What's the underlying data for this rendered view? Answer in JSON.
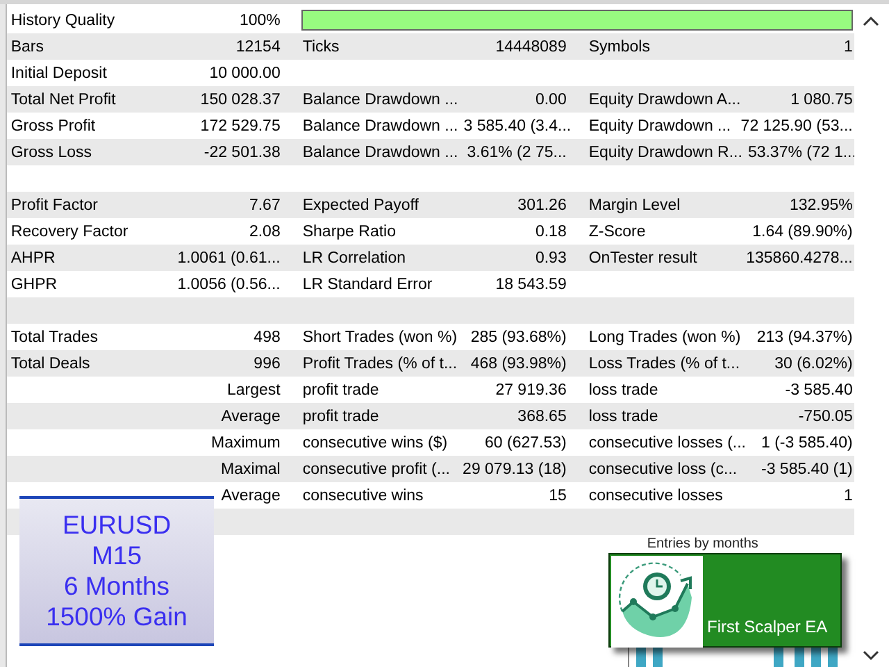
{
  "report": {
    "rows": [
      {
        "kind": "quality",
        "label": "History Quality",
        "value": "100%",
        "level": 1.0
      },
      {
        "kind": "stats",
        "cells": [
          {
            "label": "Bars",
            "value": "12154"
          },
          {
            "label": "Ticks",
            "value": "14448089"
          },
          {
            "label": "Symbols",
            "value": "1"
          }
        ]
      },
      {
        "kind": "stats",
        "cells": [
          {
            "label": "Initial Deposit",
            "value": "10 000.00"
          }
        ]
      },
      {
        "kind": "stats",
        "cells": [
          {
            "label": "Total Net Profit",
            "value": "150 028.37"
          },
          {
            "label": "Balance Drawdown ...",
            "value": "0.00"
          },
          {
            "label": "Equity Drawdown A...",
            "value": "1 080.75"
          }
        ]
      },
      {
        "kind": "stats",
        "cells": [
          {
            "label": "Gross Profit",
            "value": "172 529.75"
          },
          {
            "label": "Balance Drawdown ...",
            "value": "3 585.40 (3.4..."
          },
          {
            "label": "Equity Drawdown ...",
            "value": "72 125.90 (53..."
          }
        ]
      },
      {
        "kind": "stats",
        "cells": [
          {
            "label": "Gross Loss",
            "value": "-22 501.38"
          },
          {
            "label": "Balance Drawdown ...",
            "value": "3.61% (2 75..."
          },
          {
            "label": "Equity Drawdown R...",
            "value": "53.37% (72 1..."
          }
        ]
      },
      {
        "kind": "blank"
      },
      {
        "kind": "stats",
        "cells": [
          {
            "label": "Profit Factor",
            "value": "7.67"
          },
          {
            "label": "Expected Payoff",
            "value": "301.26"
          },
          {
            "label": "Margin Level",
            "value": "132.95%"
          }
        ]
      },
      {
        "kind": "stats",
        "cells": [
          {
            "label": "Recovery Factor",
            "value": "2.08"
          },
          {
            "label": "Sharpe Ratio",
            "value": "0.18"
          },
          {
            "label": "Z-Score",
            "value": "1.64 (89.90%)"
          }
        ]
      },
      {
        "kind": "stats",
        "cells": [
          {
            "label": "AHPR",
            "value": "1.0061 (0.61..."
          },
          {
            "label": "LR Correlation",
            "value": "0.93"
          },
          {
            "label": "OnTester result",
            "value": "135860.4278..."
          }
        ]
      },
      {
        "kind": "stats",
        "cells": [
          {
            "label": "GHPR",
            "value": "1.0056 (0.56..."
          },
          {
            "label": "LR Standard Error",
            "value": "18 543.59"
          }
        ]
      },
      {
        "kind": "blank"
      },
      {
        "kind": "stats",
        "cells": [
          {
            "label": "Total Trades",
            "value": "498"
          },
          {
            "label": "Short Trades (won %)",
            "value": "285 (93.68%)"
          },
          {
            "label": "Long Trades (won %)",
            "value": "213 (94.37%)"
          }
        ]
      },
      {
        "kind": "stats",
        "cells": [
          {
            "label": "Total Deals",
            "value": "996"
          },
          {
            "label": "Profit Trades (% of t...",
            "value": "468 (93.98%)"
          },
          {
            "label": "Loss Trades (% of t...",
            "value": "30 (6.02%)"
          }
        ]
      },
      {
        "kind": "detail",
        "heading": "Largest",
        "cells": [
          {
            "label": "profit trade",
            "value": "27 919.36"
          },
          {
            "label": "loss trade",
            "value": "-3 585.40"
          }
        ]
      },
      {
        "kind": "detail",
        "heading": "Average",
        "cells": [
          {
            "label": "profit trade",
            "value": "368.65"
          },
          {
            "label": "loss trade",
            "value": "-750.05"
          }
        ]
      },
      {
        "kind": "detail",
        "heading": "Maximum",
        "cells": [
          {
            "label": "consecutive wins ($)",
            "value": "60 (627.53)"
          },
          {
            "label": "consecutive losses (...",
            "value": "1 (-3 585.40)"
          }
        ]
      },
      {
        "kind": "detail",
        "heading": "Maximal",
        "cells": [
          {
            "label": "consecutive profit (...",
            "value": "29 079.13 (18)"
          },
          {
            "label": "consecutive loss (c...",
            "value": "-3 585.40 (1)"
          }
        ]
      },
      {
        "kind": "detail",
        "heading": "Average",
        "cells": [
          {
            "label": "consecutive wins",
            "value": "15"
          },
          {
            "label": "consecutive losses",
            "value": "1"
          }
        ]
      },
      {
        "kind": "blank"
      }
    ]
  },
  "chart": {
    "title": "Entries by months"
  },
  "promo": {
    "lines": [
      "EURUSD",
      "M15",
      "6 Months",
      "1500% Gain"
    ]
  },
  "banner": {
    "title": "First Scalper EA"
  }
}
